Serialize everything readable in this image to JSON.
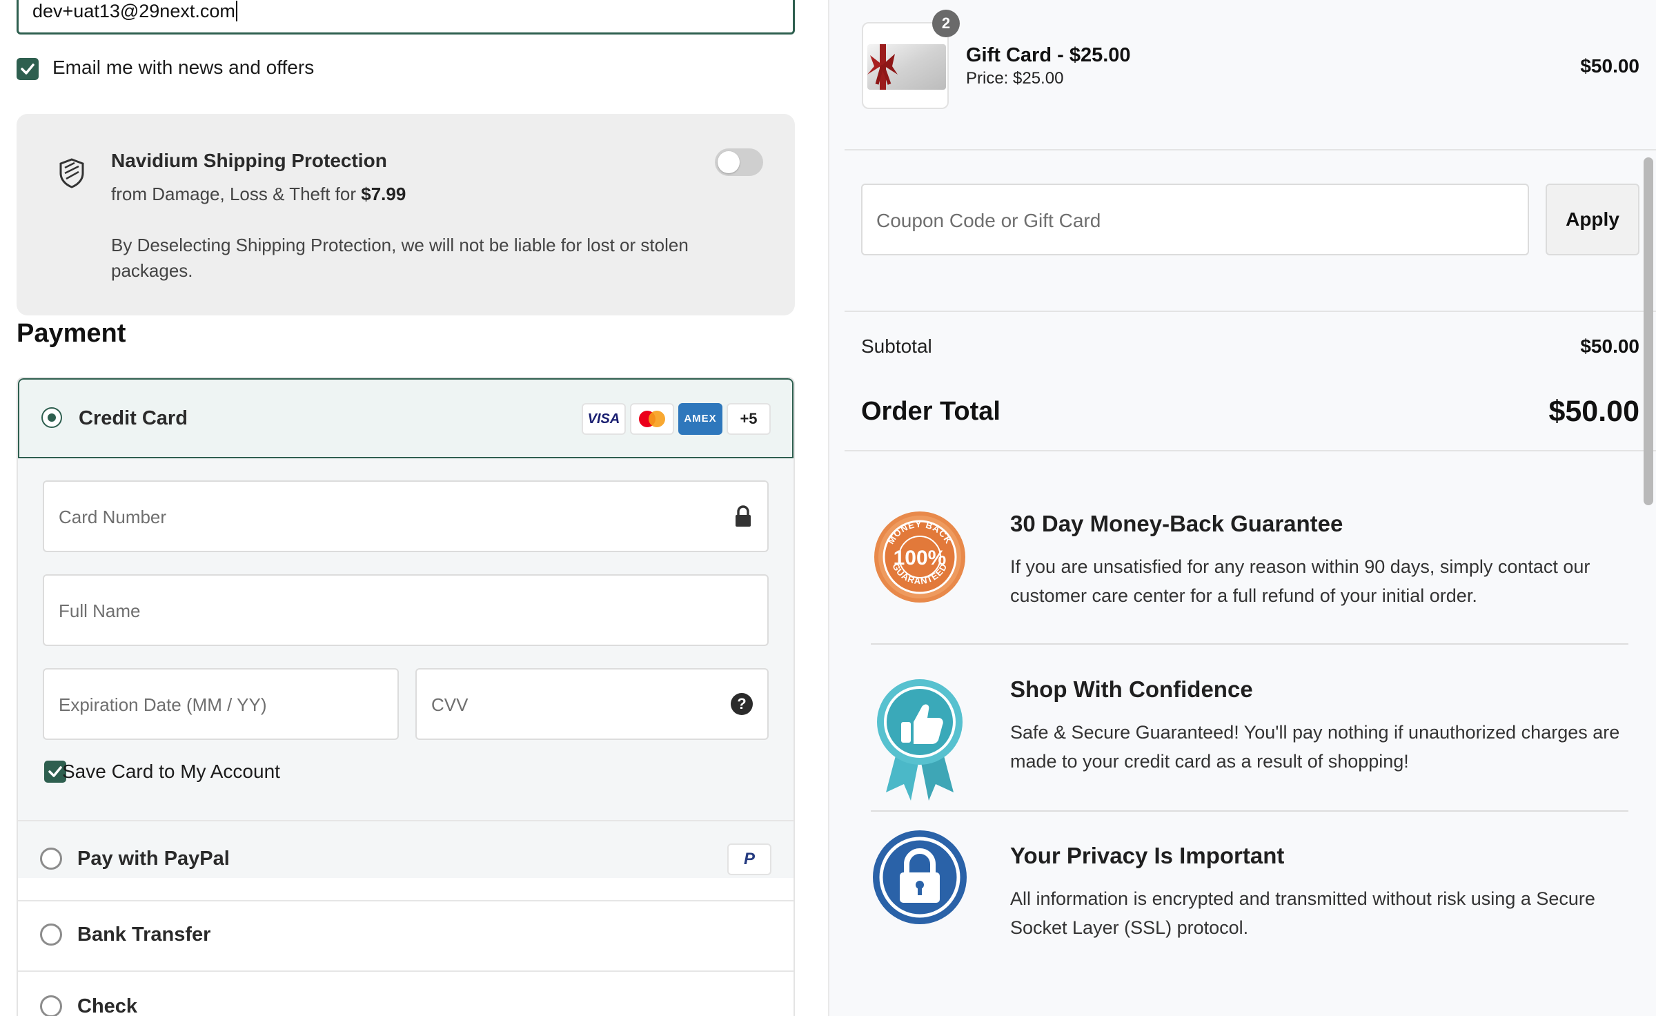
{
  "contact": {
    "email_value": "dev+uat13@29next.com",
    "newsletter_label": "Email me with news and offers",
    "newsletter_checked": true
  },
  "shipping_protection": {
    "title": "Navidium Shipping Protection",
    "subtitle_prefix": "from Damage, Loss & Theft for ",
    "price": "$7.99",
    "note": "By Deselecting Shipping Protection, we will not be liable for lost or stolen packages.",
    "enabled": false
  },
  "payment": {
    "title": "Payment",
    "credit_card": {
      "label": "Credit Card",
      "brands": [
        "VISA",
        "mastercard",
        "AMEX"
      ],
      "more_count": "+5",
      "card_number_placeholder": "Card Number",
      "full_name_placeholder": "Full Name",
      "expiration_placeholder": "Expiration Date (MM / YY)",
      "cvv_placeholder": "CVV",
      "save_card_label": "Save Card to My Account"
    },
    "paypal_label": "Pay with PayPal",
    "bank_label": "Bank Transfer",
    "check_label": "Check",
    "colors": {
      "accent": "#2e5f4f"
    }
  },
  "summary": {
    "item": {
      "quantity": "2",
      "name": "Gift Card - $25.00",
      "price_line": "Price: $25.00",
      "line_total": "$50.00"
    },
    "coupon_placeholder": "Coupon Code or Gift Card",
    "apply_label": "Apply",
    "subtotal_label": "Subtotal",
    "subtotal_value": "$50.00",
    "total_label": "Order Total",
    "total_value": "$50.00"
  },
  "guarantees": [
    {
      "icon": "money-back-badge-icon",
      "badge_text": "MONEY BACK 100% GUARANTEED",
      "title": "30 Day Money-Back Guarantee",
      "text": "If you are unsatisfied for any reason within 90 days, simply contact our customer care center for a full refund of your initial order."
    },
    {
      "icon": "thumbs-up-ribbon-icon",
      "title": "Shop With Confidence",
      "text": "Safe & Secure Guaranteed! You'll pay nothing if unauthorized charges are made to your credit card as a result of shopping!"
    },
    {
      "icon": "padlock-seal-icon",
      "title": "Your Privacy Is Important",
      "text": "All information is encrypted and transmitted without risk using a Secure Socket Layer (SSL) protocol."
    }
  ]
}
